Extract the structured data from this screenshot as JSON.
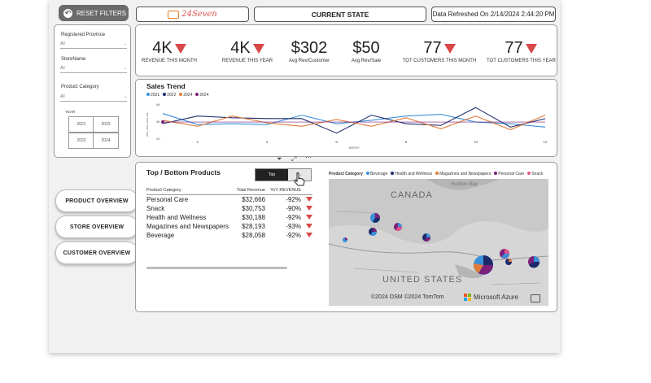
{
  "header": {
    "reset_label": "RESET FILTERS",
    "logo_text": "24Seven",
    "current_state": "CURRENT STATE",
    "refreshed": "Data Refreshed On 2/14/2024 2:44:20 PM"
  },
  "filters": {
    "province_label": "Registered Province",
    "province_value": "All",
    "store_label": "StoreName",
    "store_value": "All",
    "category_label": "Product Category",
    "category_value": "All",
    "year_label": "YEAR",
    "years": [
      "2021",
      "2023",
      "2022",
      "2024"
    ]
  },
  "kpis": [
    {
      "value": "4K",
      "label": "REVENUE THIS MONTH",
      "down": true
    },
    {
      "value": "4K",
      "label": "REVENUE THIS YEAR",
      "down": true
    },
    {
      "value": "$302",
      "label": "Avg Rev/Customer",
      "down": false
    },
    {
      "value": "$50",
      "label": "Avg Rev/Sale",
      "down": false
    },
    {
      "value": "77",
      "label": "TOT CUSTOMERS THIS MONTH",
      "down": true
    },
    {
      "value": "77",
      "label": "TOT CUSTOMERS THIS YEAR",
      "down": true
    }
  ],
  "nav": {
    "product": "PRODUCT OVERVIEW",
    "store": "STORE OVERVIEW",
    "customer": "CUSTOMER OVERVIEW"
  },
  "trend": {
    "title": "Sales Trend",
    "xlabel": "MONTH",
    "ylabel": "2021, 2022, 2023 and...",
    "legend": [
      "2021",
      "2022",
      "2024",
      "2024"
    ],
    "colors": {
      "y2021": "#3a8fd9",
      "y2022": "#1b2a6b",
      "y2024a": "#e07b3c",
      "y2024b": "#7a1f7a"
    }
  },
  "chart_data": {
    "type": "line",
    "x": [
      1,
      2,
      3,
      4,
      5,
      6,
      7,
      8,
      9,
      10,
      11,
      12
    ],
    "xticks": [
      "2",
      "4",
      "6",
      "8",
      "10",
      "12"
    ],
    "yticks": [
      "6K",
      "4K",
      "2K"
    ],
    "ylim": [
      2,
      6
    ],
    "series": [
      {
        "name": "2021",
        "values": [
          4.9,
          3.6,
          3.7,
          3.6,
          4.7,
          3.7,
          4.1,
          4.6,
          4.8,
          3.9,
          3.7,
          3.3
        ]
      },
      {
        "name": "2022",
        "values": [
          3.7,
          4.6,
          4.4,
          4.3,
          4.3,
          2.6,
          4.7,
          3.7,
          3.5,
          5.6,
          3.3,
          4.3
        ]
      },
      {
        "name": "2024",
        "values": [
          4.1,
          3.4,
          4.6,
          3.8,
          3.4,
          4.2,
          3.4,
          4.4,
          3.1,
          4.6,
          3.0,
          4.7
        ]
      },
      {
        "name": "2024",
        "values": [
          3.9,
          3.9,
          3.9,
          3.9,
          3.9,
          3.9,
          3.9,
          3.9,
          3.9,
          3.9,
          3.9,
          3.9
        ]
      }
    ]
  },
  "topbottom": {
    "title": "Top / Bottom Products",
    "toggle_on": "Top",
    "toggle_off": "B...",
    "col1": "Product Category",
    "col2": "Total Revenue",
    "col3": "YoY REVENUE",
    "rows": [
      {
        "name": "Personal Care",
        "rev": "$32,666",
        "yoy": "-92%"
      },
      {
        "name": "Snack",
        "rev": "$30,753",
        "yoy": "-90%"
      },
      {
        "name": "Health and Wellness",
        "rev": "$30,188",
        "yoy": "-92%"
      },
      {
        "name": "Magazines and Newspapers",
        "rev": "$28,193",
        "yoy": "-93%"
      },
      {
        "name": "Beverage",
        "rev": "$28,058",
        "yoy": "-92%"
      }
    ]
  },
  "map": {
    "legend_title": "Product Category",
    "legend": [
      {
        "name": "Beverage",
        "color": "#3a8fd9"
      },
      {
        "name": "Health and Wellness",
        "color": "#1b2a6b"
      },
      {
        "name": "Magazines and Newspapers",
        "color": "#e07b3c"
      },
      {
        "name": "Personal Care",
        "color": "#7a1f7a"
      },
      {
        "name": "Snack",
        "color": "#e0538a"
      }
    ],
    "canada": "CANADA",
    "hudson": "Hudson Bay",
    "us": "UNITED STATES",
    "copyright": "©2024 OSM ©2024 TomTom",
    "azure": "Microsoft Azure"
  }
}
